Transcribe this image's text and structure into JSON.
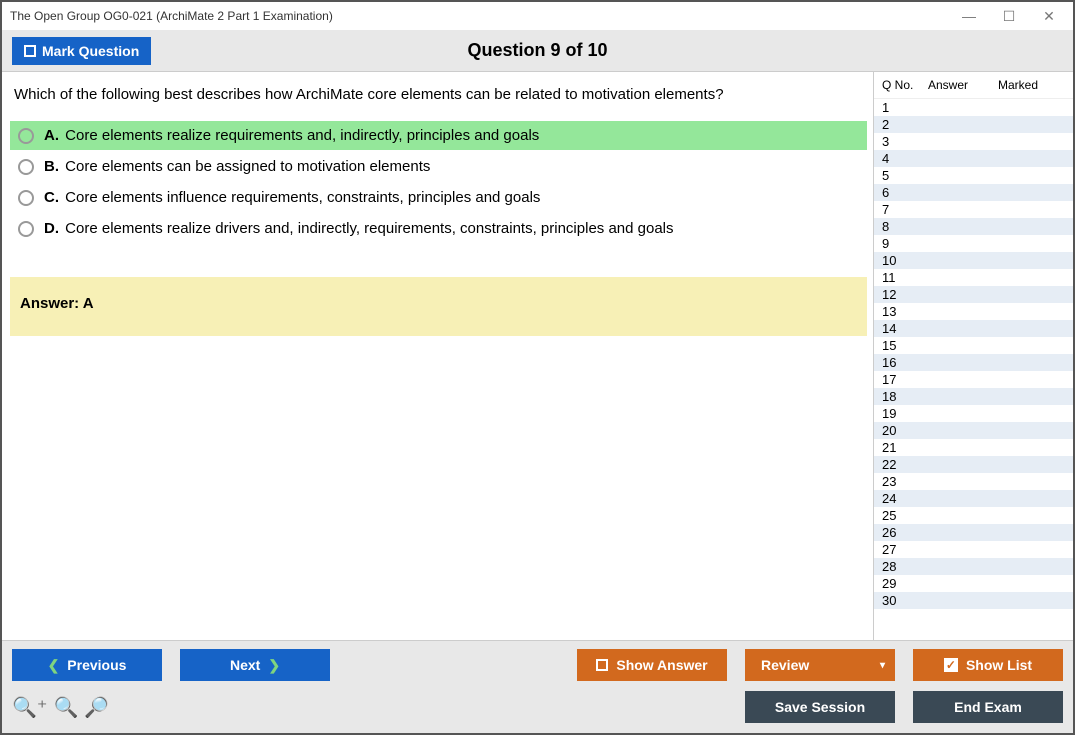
{
  "window": {
    "title": "The Open Group OG0-021 (ArchiMate 2 Part 1 Examination)"
  },
  "header": {
    "mark_label": "Mark Question",
    "counter": "Question 9 of 10"
  },
  "question": {
    "text": "Which of the following best describes how ArchiMate core elements can be related to motivation elements?",
    "options": [
      {
        "letter": "A.",
        "text": "Core elements realize requirements and, indirectly, principles and goals",
        "selected": true
      },
      {
        "letter": "B.",
        "text": "Core elements can be assigned to motivation elements",
        "selected": false
      },
      {
        "letter": "C.",
        "text": "Core elements influence requirements, constraints, principles and goals",
        "selected": false
      },
      {
        "letter": "D.",
        "text": "Core elements realize drivers and, indirectly, requirements, constraints, principles and goals",
        "selected": false
      }
    ],
    "answer_label": "Answer: ",
    "answer_value": "A"
  },
  "sidebar": {
    "headers": {
      "qno": "Q No.",
      "answer": "Answer",
      "marked": "Marked"
    },
    "rows": [
      1,
      2,
      3,
      4,
      5,
      6,
      7,
      8,
      9,
      10,
      11,
      12,
      13,
      14,
      15,
      16,
      17,
      18,
      19,
      20,
      21,
      22,
      23,
      24,
      25,
      26,
      27,
      28,
      29,
      30
    ]
  },
  "footer": {
    "previous": "Previous",
    "next": "Next",
    "show_answer": "Show Answer",
    "review": "Review",
    "show_list": "Show List",
    "save_session": "Save Session",
    "end_exam": "End Exam"
  }
}
